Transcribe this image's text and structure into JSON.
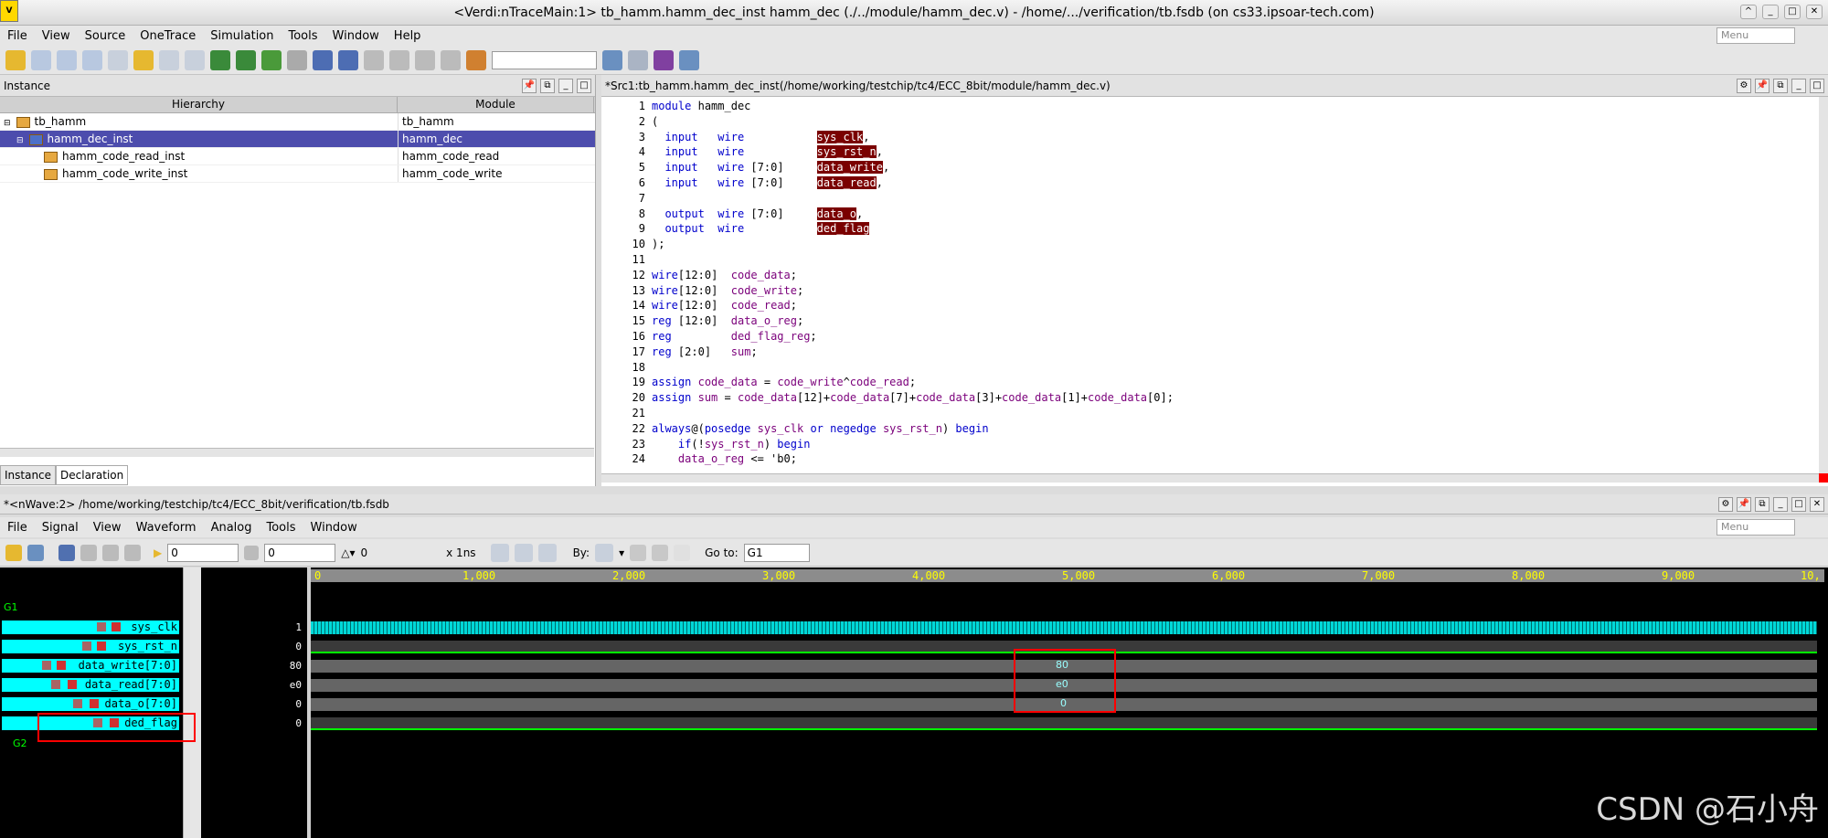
{
  "app": {
    "title": "<Verdi:nTraceMain:1> tb_hamm.hamm_dec_inst hamm_dec (./../module/hamm_dec.v) - /home/.../verification/tb.fsdb (on cs33.ipsoar-tech.com)"
  },
  "menubar": {
    "items": [
      "File",
      "View",
      "Source",
      "OneTrace",
      "Simulation",
      "Tools",
      "Window",
      "Help"
    ],
    "menu_placeholder": "Menu"
  },
  "instance_pane": {
    "title": "Instance",
    "col_hierarchy": "Hierarchy",
    "col_module": "Module",
    "rows": [
      {
        "name": "tb_hamm",
        "module": "tb_hamm"
      },
      {
        "name": "hamm_dec_inst",
        "module": "hamm_dec"
      },
      {
        "name": "hamm_code_read_inst",
        "module": "hamm_code_read"
      },
      {
        "name": "hamm_code_write_inst",
        "module": "hamm_code_write"
      }
    ],
    "tabs": [
      "Instance",
      "Declaration"
    ]
  },
  "source_pane": {
    "title": "*Src1:tb_hamm.hamm_dec_inst(/home/working/testchip/tc4/ECC_8bit/module/hamm_dec.v)",
    "lines": [
      {
        "n": "1",
        "t": "module hamm_dec"
      },
      {
        "n": "2",
        "t": "("
      },
      {
        "n": "3",
        "t": "  input   wire           ",
        "h": "sys_clk",
        "e": ","
      },
      {
        "n": "4",
        "t": "  input   wire           ",
        "h": "sys_rst_n",
        "e": ","
      },
      {
        "n": "5",
        "t": "  input   wire [7:0]     ",
        "h": "data_write",
        "e": ","
      },
      {
        "n": "6",
        "t": "  input   wire [7:0]     ",
        "h": "data_read",
        "e": ","
      },
      {
        "n": "7",
        "t": ""
      },
      {
        "n": "8",
        "t": "  output  wire [7:0]     ",
        "h": "data_o",
        "e": ","
      },
      {
        "n": "9",
        "t": "  output  wire           ",
        "h": "ded_flag",
        "e": ""
      },
      {
        "n": "10",
        "t": ");"
      },
      {
        "n": "11",
        "t": ""
      },
      {
        "n": "12",
        "t": "wire[12:0]  code_data;"
      },
      {
        "n": "13",
        "t": "wire[12:0]  code_write;"
      },
      {
        "n": "14",
        "t": "wire[12:0]  code_read;"
      },
      {
        "n": "15",
        "t": "reg [12:0]  data_o_reg;"
      },
      {
        "n": "16",
        "t": "reg         ded_flag_reg;"
      },
      {
        "n": "17",
        "t": "reg [2:0]   sum;"
      },
      {
        "n": "18",
        "t": ""
      },
      {
        "n": "19",
        "t": "assign code_data = code_write^code_read;"
      },
      {
        "n": "20",
        "t": "assign sum = code_data[12]+code_data[7]+code_data[3]+code_data[1]+code_data[0];"
      },
      {
        "n": "21",
        "t": ""
      },
      {
        "n": "22",
        "t": "always@(posedge sys_clk or negedge sys_rst_n) begin"
      },
      {
        "n": "23",
        "t": "    if(!sys_rst_n) begin"
      },
      {
        "n": "24",
        "t": "    data_o_reg <= 'b0;"
      }
    ]
  },
  "wave_pane": {
    "title": "*<nWave:2> /home/working/testchip/tc4/ECC_8bit/verification/tb.fsdb",
    "menu": [
      "File",
      "Signal",
      "View",
      "Waveform",
      "Analog",
      "Tools",
      "Window"
    ],
    "menu_placeholder": "Menu",
    "cursor": "0",
    "marker": "0",
    "delta": "0",
    "unit": "x 1ns",
    "by_label": "By:",
    "goto_label": "Go to:",
    "goto_value": "G1",
    "ticks": [
      "0",
      "1,000",
      "2,000",
      "3,000",
      "4,000",
      "5,000",
      "6,000",
      "7,000",
      "8,000",
      "9,000",
      "10,"
    ],
    "groups": {
      "g1": "G1",
      "g2": "G2"
    },
    "signals": [
      {
        "name": "sys_clk",
        "value": "1"
      },
      {
        "name": "sys_rst_n",
        "value": "0"
      },
      {
        "name": "data_write[7:0]",
        "value": "80"
      },
      {
        "name": "data_read[7:0]",
        "value": "e0"
      },
      {
        "name": "data_o[7:0]",
        "value": "0"
      },
      {
        "name": "ded_flag",
        "value": "0"
      }
    ],
    "bus_labels": [
      "80",
      "e0",
      "0"
    ]
  },
  "watermark": "CSDN @石小舟"
}
